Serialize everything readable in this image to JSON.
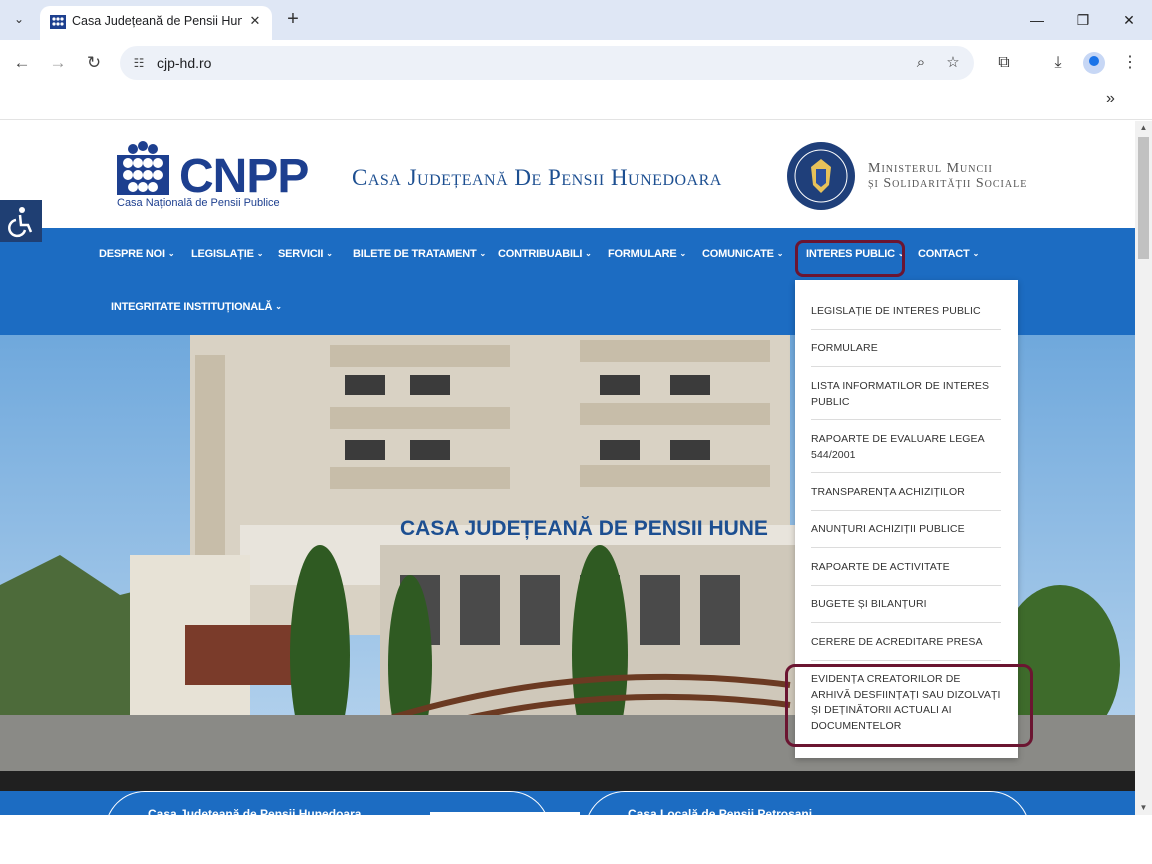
{
  "browser": {
    "tab_title": "Casa Județeană de Pensii Hunedoara",
    "url": "cjp-hd.ro"
  },
  "header": {
    "logo_text": "CNPP",
    "logo_subtitle": "Casa Națională de Pensii Publice",
    "site_title": "Casa Județeană De Pensii Hunedoara",
    "ministry_line1": "Ministerul Muncii",
    "ministry_line2": "și Solidarității Sociale"
  },
  "nav": {
    "items": [
      {
        "label": "DESPRE NOI"
      },
      {
        "label": "LEGISLAȚIE"
      },
      {
        "label": "SERVICII"
      },
      {
        "label": "BILETE DE TRATAMENT"
      },
      {
        "label": "CONTRIBUABILI"
      },
      {
        "label": "FORMULARE"
      },
      {
        "label": "COMUNICATE"
      },
      {
        "label": "INTERES PUBLIC"
      },
      {
        "label": "CONTACT"
      },
      {
        "label": "INTEGRITATE INSTITUȚIONALĂ"
      }
    ]
  },
  "dropdown": {
    "items": [
      {
        "label": "LEGISLAȚIE DE INTERES PUBLIC"
      },
      {
        "label": "FORMULARE"
      },
      {
        "label": "LISTA INFORMATILOR DE INTERES PUBLIC"
      },
      {
        "label": "RAPOARTE DE EVALUARE LEGEA 544/2001"
      },
      {
        "label": "TRANSPARENȚA ACHIZIȚILOR"
      },
      {
        "label": "ANUNȚURI ACHIZIȚII PUBLICE"
      },
      {
        "label": "RAPOARTE DE ACTIVITATE"
      },
      {
        "label": "BUGETE ȘI BILANȚURI"
      },
      {
        "label": "CERERE DE ACREDITARE PRESA"
      },
      {
        "label": "EVIDENȚA CREATORILOR DE ARHIVĂ DESFIINȚAȚI SAU DIZOLVAȚI ȘI DEȚINĂTORII ACTUALI AI DOCUMENTELOR"
      }
    ]
  },
  "hero": {
    "building_sign": "CASA JUDEȚEANĂ DE PENSII HUNE"
  },
  "footer_cards": [
    {
      "label": "Casa Județeană de Pensii Hunedoara"
    },
    {
      "label": "Casa Locală de Pensii Petroșani"
    }
  ],
  "colors": {
    "nav_blue": "#1c6cc2",
    "logo_blue": "#1d3f8f",
    "highlight": "#6b1531"
  }
}
